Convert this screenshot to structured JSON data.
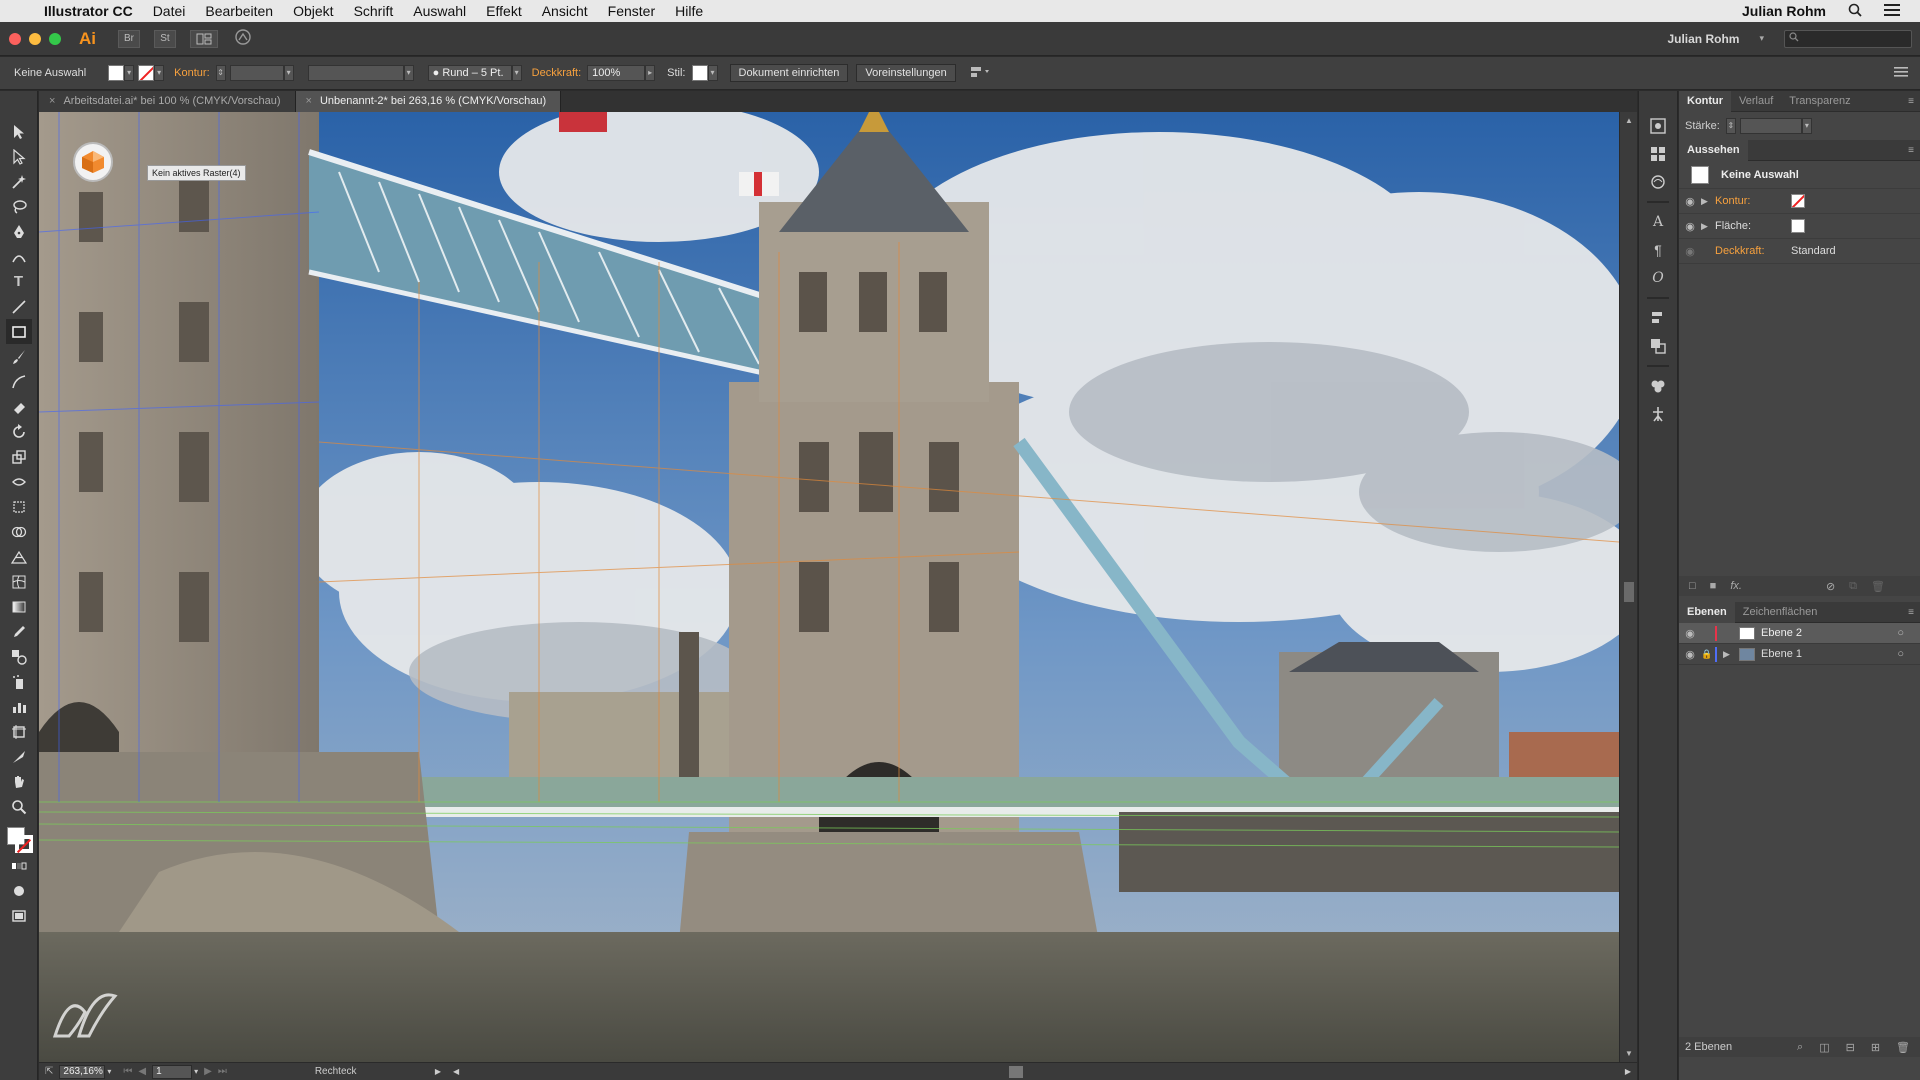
{
  "menubar": {
    "app_name": "Illustrator CC",
    "menus": [
      "Datei",
      "Bearbeiten",
      "Objekt",
      "Schrift",
      "Auswahl",
      "Effekt",
      "Ansicht",
      "Fenster",
      "Hilfe"
    ],
    "user": "Julian Rohm"
  },
  "appbar": {
    "logo": "Ai",
    "bridge_label": "Br",
    "stock_label": "St",
    "workspace_user": "Julian Rohm"
  },
  "controlbar": {
    "selection_label": "Keine Auswahl",
    "stroke_label": "Kontur:",
    "brush_label": "Rund – 5 Pt.",
    "opacity_label": "Deckkraft:",
    "opacity_value": "100%",
    "style_label": "Stil:",
    "document_setup_button": "Dokument einrichten",
    "preferences_button": "Voreinstellungen"
  },
  "tabs": [
    {
      "label": "Arbeitsdatei.ai* bei 100 % (CMYK/Vorschau)",
      "active": false
    },
    {
      "label": "Unbenannt-2* bei 263,16 % (CMYK/Vorschau)",
      "active": true
    }
  ],
  "canvas": {
    "tooltip": "Kein aktives Raster(4)"
  },
  "statusbar": {
    "zoom": "263,16%",
    "artboard": "1",
    "tool": "Rechteck"
  },
  "panels": {
    "stroke_tabs": [
      "Kontur",
      "Verlauf",
      "Transparenz"
    ],
    "stroke_weight_label": "Stärke:",
    "appearance_title": "Aussehen",
    "appearance_selection": "Keine Auswahl",
    "appearance_rows": [
      {
        "label": "Kontur:"
      },
      {
        "label": "Fläche:"
      },
      {
        "label": "Deckkraft:",
        "value": "Standard"
      }
    ],
    "layers_tabs": [
      "Ebenen",
      "Zeichenflächen"
    ],
    "layers": [
      {
        "name": "Ebene 2",
        "color": "#e8334a",
        "selected": true
      },
      {
        "name": "Ebene 1",
        "color": "#4f6ef7",
        "selected": false
      }
    ],
    "layers_count": "2 Ebenen",
    "fx_label": "fx."
  },
  "colors": {
    "accent_orange": "#f7931e",
    "ui_dark": "#3a3a3a"
  }
}
